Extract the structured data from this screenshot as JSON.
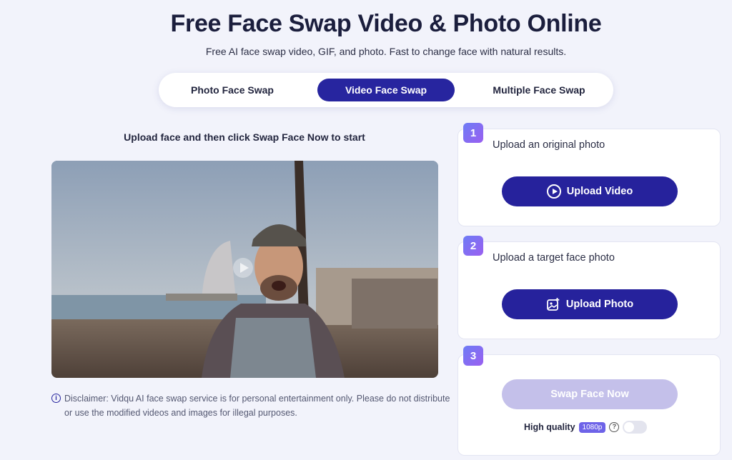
{
  "header": {
    "title": "Free Face Swap Video & Photo Online",
    "subtitle": "Free AI face swap video, GIF, and photo. Fast to change face with natural results."
  },
  "tabs": [
    {
      "label": "Photo Face Swap",
      "active": false
    },
    {
      "label": "Video Face Swap",
      "active": true
    },
    {
      "label": "Multiple Face Swap",
      "active": false
    }
  ],
  "left": {
    "upload_hint": "Upload face and then click Swap Face Now to start",
    "disclaimer": "Disclaimer: Vidqu AI face swap service is for personal entertainment only. Please do not distribute or use the modified videos and images for illegal purposes."
  },
  "steps": [
    {
      "number": "1",
      "label": "Upload an original photo",
      "button": "Upload Video",
      "icon": "play-circle-icon"
    },
    {
      "number": "2",
      "label": "Upload a target face photo",
      "button": "Upload Photo",
      "icon": "image-add-icon"
    },
    {
      "number": "3",
      "button": "Swap Face Now",
      "disabled": true
    }
  ],
  "quality": {
    "label": "High quality",
    "badge": "1080p",
    "help": "?",
    "enabled": false
  },
  "colors": {
    "accent": "#27259f",
    "disabled_button": "#c4c0ea",
    "step_badge_from": "#6d7cf5",
    "step_badge_to": "#9a5ff0",
    "background": "#f2f3fb"
  }
}
